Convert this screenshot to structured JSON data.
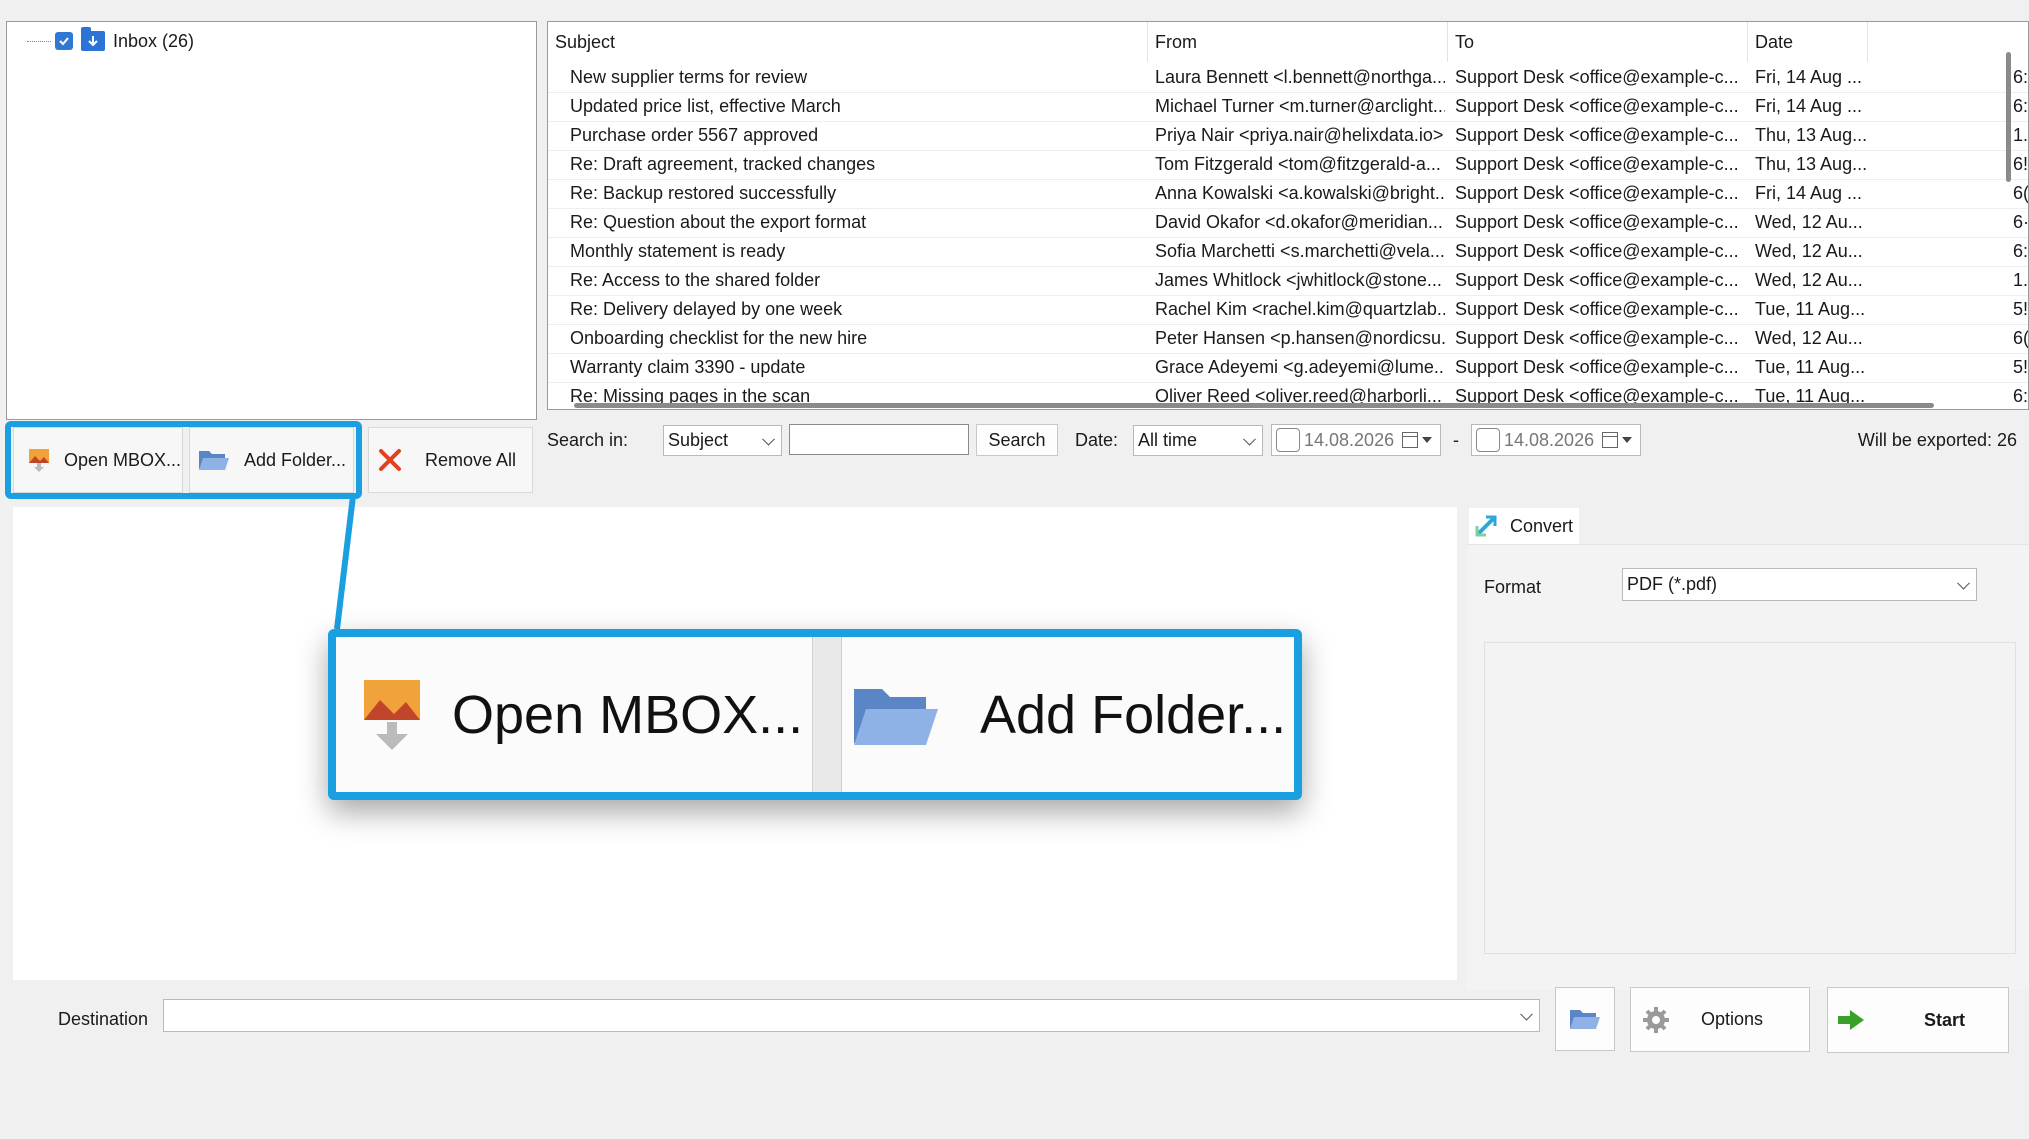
{
  "tree": {
    "inbox_label": "Inbox (26)"
  },
  "grid": {
    "columns": [
      "Subject",
      "From",
      "To",
      "Date"
    ],
    "rows": [
      {
        "subject": "New supplier terms for review",
        "from": "Laura Bennett <l.bennett@northga...",
        "to": "Support Desk <office@example-c...",
        "date": "Fri, 14 Aug ...",
        "size": "6:"
      },
      {
        "subject": "Updated price list, effective March",
        "from": "Michael Turner <m.turner@arclight...",
        "to": "Support Desk <office@example-c...",
        "date": "Fri, 14 Aug ...",
        "size": "6:"
      },
      {
        "subject": "Purchase order 5567 approved",
        "from": "Priya Nair <priya.nair@helixdata.io>",
        "to": "Support Desk <office@example-c...",
        "date": "Thu, 13 Aug...",
        "size": "1.:"
      },
      {
        "subject": "Re: Draft agreement, tracked changes",
        "from": "Tom Fitzgerald <tom@fitzgerald-a...",
        "to": "Support Desk <office@example-c...",
        "date": "Thu, 13 Aug...",
        "size": "6!"
      },
      {
        "subject": "Re: Backup restored successfully",
        "from": "Anna Kowalski <a.kowalski@bright...",
        "to": "Support Desk <office@example-c...",
        "date": "Fri, 14 Aug ...",
        "size": "6("
      },
      {
        "subject": "Re: Question about the export format",
        "from": "David Okafor <d.okafor@meridian...",
        "to": "Support Desk <office@example-c...",
        "date": "Wed, 12 Au...",
        "size": "6·"
      },
      {
        "subject": "Monthly statement is ready",
        "from": "Sofia Marchetti <s.marchetti@vela...",
        "to": "Support Desk <office@example-c...",
        "date": "Wed, 12 Au...",
        "size": "6:"
      },
      {
        "subject": "Re: Access to the shared folder",
        "from": "James Whitlock <jwhitlock@stone...",
        "to": "Support Desk <office@example-c...",
        "date": "Wed, 12 Au...",
        "size": "1.:"
      },
      {
        "subject": "Re: Delivery delayed by one week",
        "from": "Rachel Kim <rachel.kim@quartzlab...",
        "to": "Support Desk <office@example-c...",
        "date": "Tue, 11 Aug...",
        "size": "5!"
      },
      {
        "subject": "Onboarding checklist for the new hire",
        "from": "Peter Hansen <p.hansen@nordicsu...",
        "to": "Support Desk <office@example-c...",
        "date": "Wed, 12 Au...",
        "size": "6("
      },
      {
        "subject": "Warranty claim 3390 - update",
        "from": "Grace Adeyemi <g.adeyemi@lume...",
        "to": "Support Desk <office@example-c...",
        "date": "Tue, 11 Aug...",
        "size": "5!"
      },
      {
        "subject": "Re: Missing pages in the scan",
        "from": "Oliver Reed <oliver.reed@harborli...",
        "to": "Support Desk <office@example-c...",
        "date": "Tue, 11 Aug...",
        "size": "6:"
      }
    ]
  },
  "toolbar": {
    "open_mbox": "Open MBOX...",
    "add_folder": "Add Folder...",
    "remove_all": "Remove All"
  },
  "search": {
    "search_in_label": "Search in:",
    "field_value": "Subject",
    "query_value": "",
    "search_button": "Search",
    "date_label": "Date:",
    "date_range_value": "All time",
    "date_from": "14.08.2026",
    "date_sep": "-",
    "date_to": "14.08.2026",
    "export_count": "Will be exported: 26"
  },
  "convert": {
    "tab_label": "Convert",
    "format_label": "Format",
    "format_value": "PDF (*.pdf)"
  },
  "bottom": {
    "destination_label": "Destination",
    "destination_value": "",
    "options_button": "Options",
    "start_button": "Start"
  },
  "zoom": {
    "open_mbox": "Open MBOX...",
    "add_folder": "Add Folder..."
  },
  "colors": {
    "highlight": "#1aa0e0",
    "start_arrow": "#3aa02a",
    "remove_x": "#e2401e"
  }
}
